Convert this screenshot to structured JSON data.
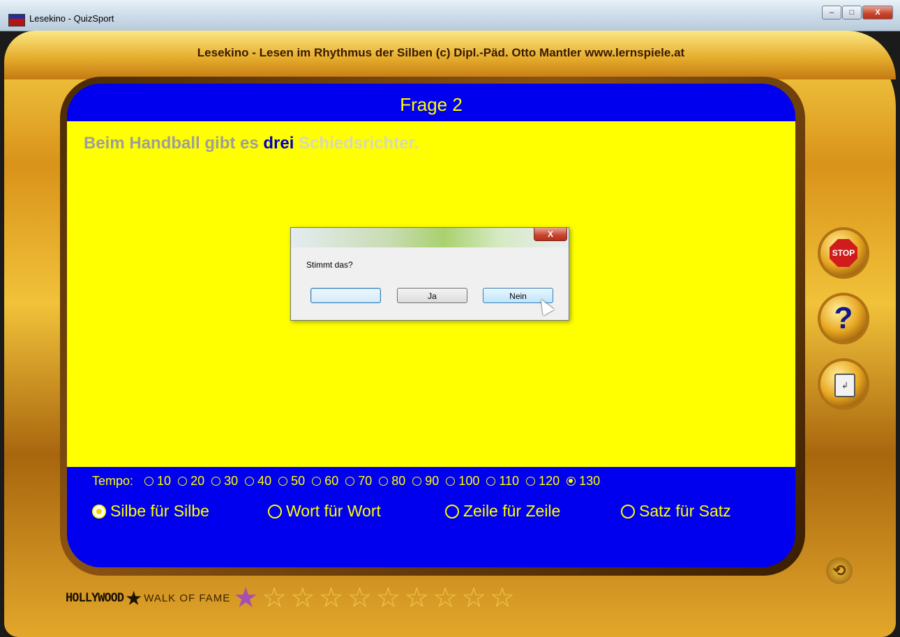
{
  "window": {
    "title": "Lesekino - QuizSport",
    "minimize": "–",
    "maximize": "□",
    "close": "X"
  },
  "header": "Lesekino - Lesen im Rhythmus der Silben  (c) Dipl.-Päd. Otto Mantler  www.lernspiele.at",
  "question": {
    "title": "Frage 2",
    "read_text": "Beim Handball gibt es ",
    "current_word": "drei",
    "unread_text": " Schiedsrichter."
  },
  "tempo": {
    "label": "Tempo:",
    "options": [
      "10",
      "20",
      "30",
      "40",
      "50",
      "60",
      "70",
      "80",
      "90",
      "100",
      "110",
      "120",
      "130"
    ],
    "selected": "130"
  },
  "modes": {
    "options": [
      "Silbe für Silbe",
      "Wort für Wort",
      "Zeile für Zeile",
      "Satz für Satz"
    ],
    "selected": "Silbe für Silbe"
  },
  "side_buttons": {
    "stop": "STOP",
    "help": "?",
    "page": "↲",
    "restart": "⟲"
  },
  "walk_of_fame": {
    "hollywood": "HOLLYWOOD",
    "walk": "WALK OF FAME",
    "filled_stars": 1,
    "total_stars": 10
  },
  "dialog": {
    "close": "X",
    "message": "Stimmt das?",
    "button1": "",
    "button2": "Ja",
    "button3": "Nein"
  }
}
